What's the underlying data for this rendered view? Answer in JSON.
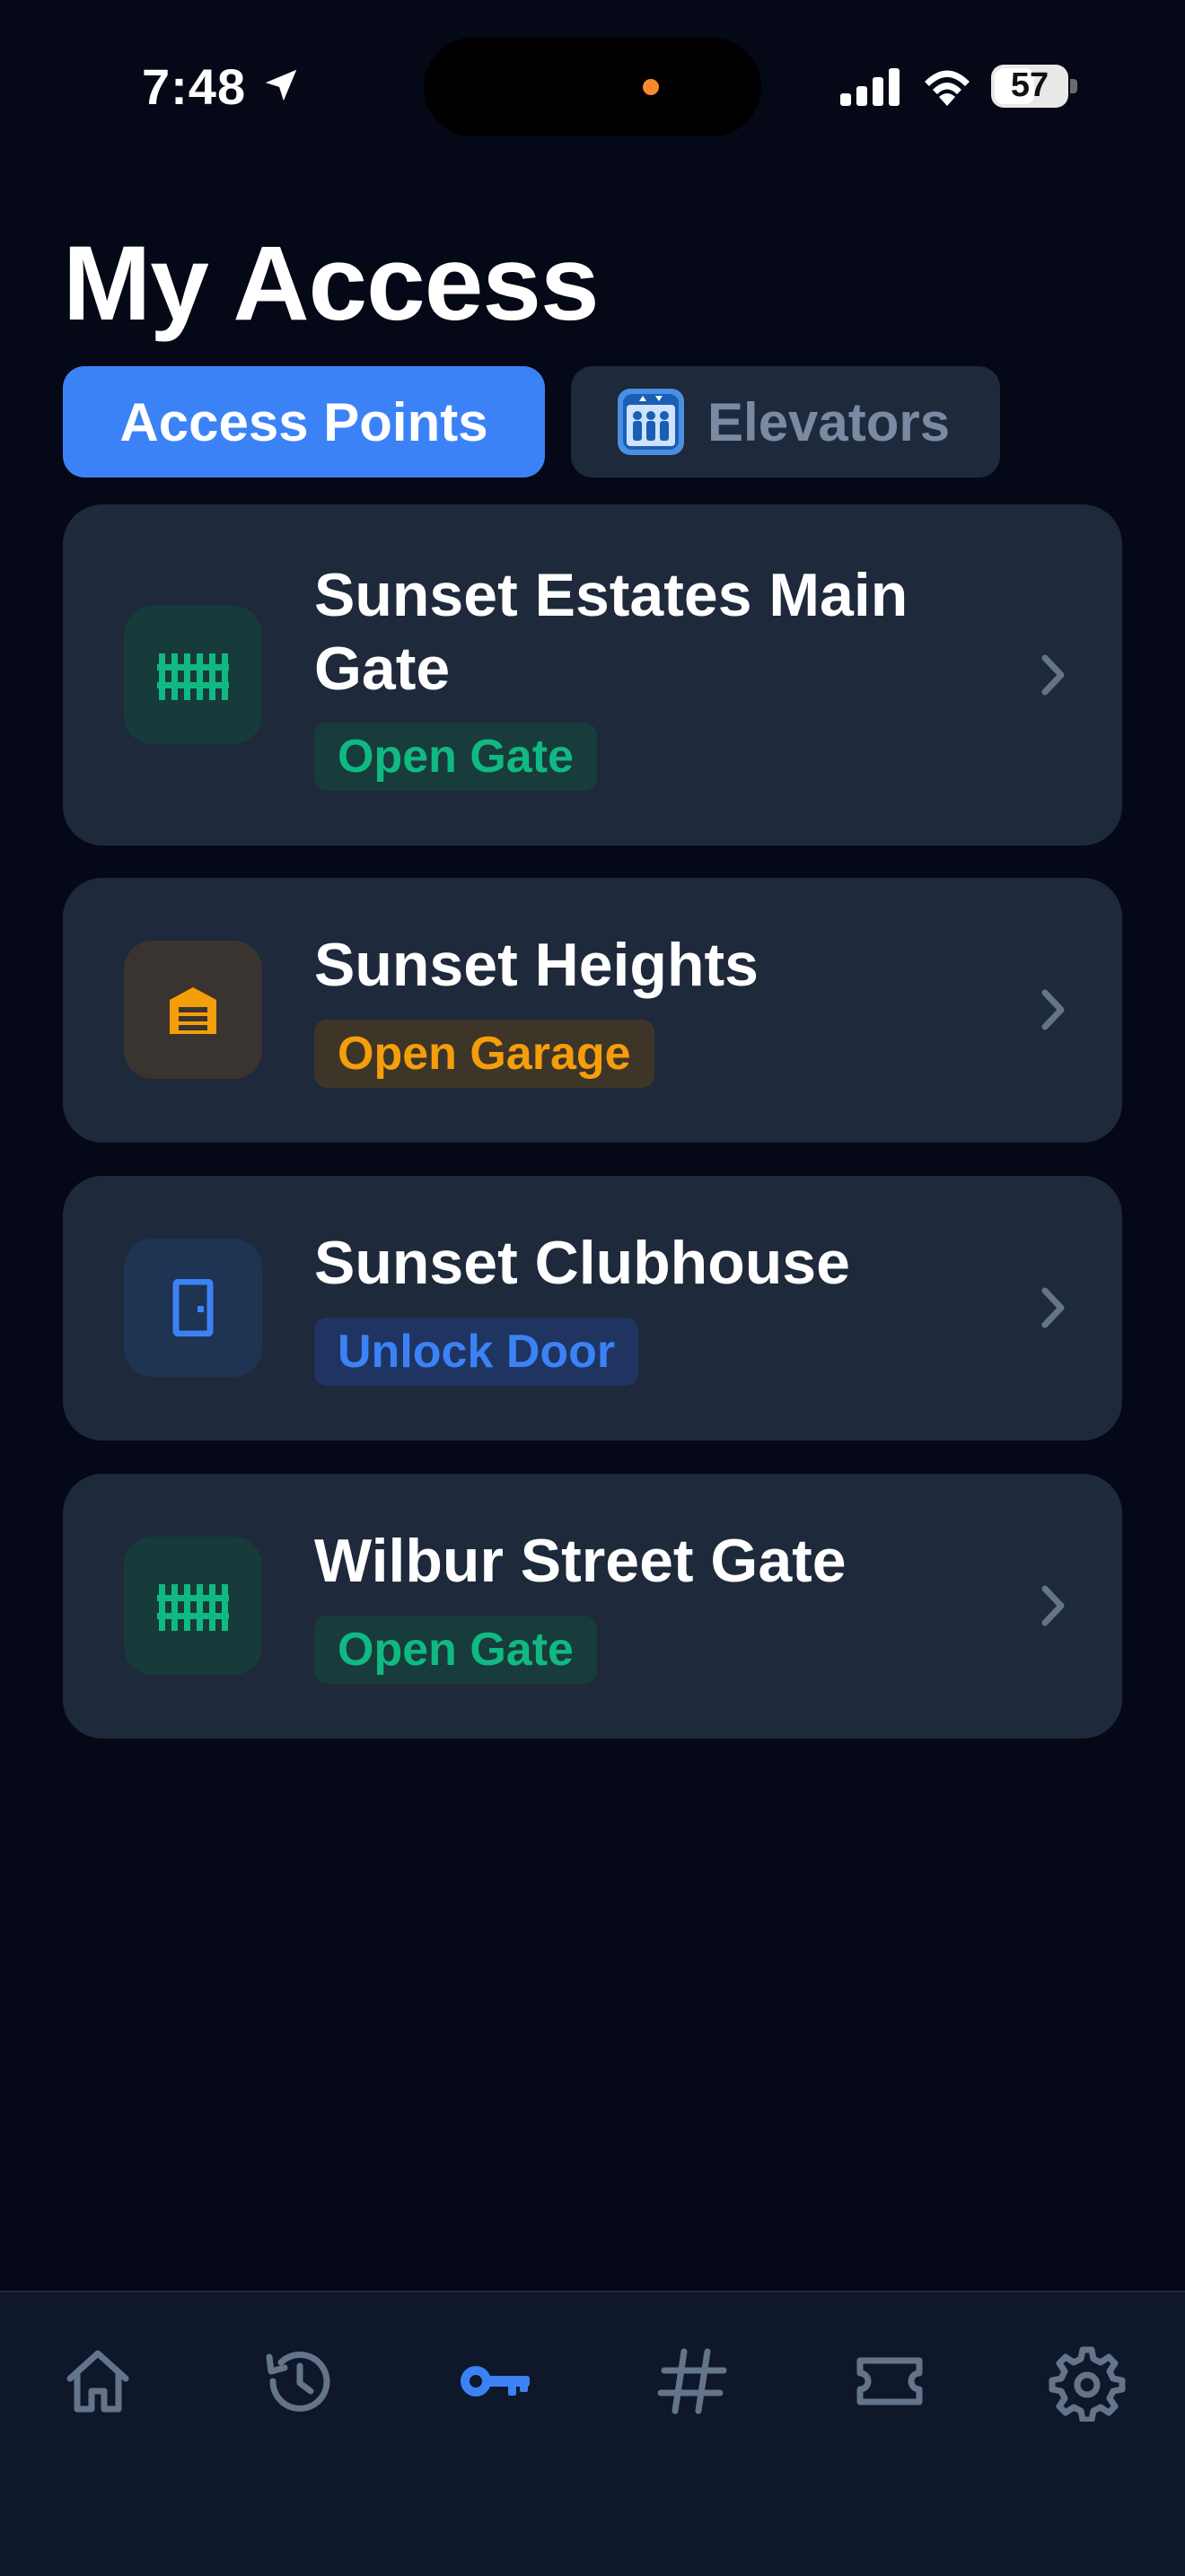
{
  "status_bar": {
    "time": "7:48",
    "battery": "57",
    "battery_level_percent": 57
  },
  "page": {
    "title": "My Access"
  },
  "tabs": [
    {
      "label": "Access Points",
      "active": true
    },
    {
      "label": "Elevators",
      "active": false,
      "icon": "elevator-icon"
    }
  ],
  "access_points": [
    {
      "name": "Sunset Estates Main Gate",
      "action": "Open Gate",
      "icon": "gate-icon",
      "color": "#10b981"
    },
    {
      "name": "Sunset Heights",
      "action": "Open Garage",
      "icon": "garage-icon",
      "color": "#f59e0b"
    },
    {
      "name": "Sunset Clubhouse",
      "action": "Unlock Door",
      "icon": "door-icon",
      "color": "#3b82f6"
    },
    {
      "name": "Wilbur Street Gate",
      "action": "Open Gate",
      "icon": "gate-icon",
      "color": "#10b981"
    }
  ],
  "bottom_nav": [
    {
      "icon": "home-icon",
      "active": false
    },
    {
      "icon": "history-icon",
      "active": false
    },
    {
      "icon": "key-icon",
      "active": true
    },
    {
      "icon": "hashtag-icon",
      "active": false
    },
    {
      "icon": "ticket-icon",
      "active": false
    },
    {
      "icon": "gear-icon",
      "active": false
    }
  ],
  "colors": {
    "background": "#050816",
    "card": "#1e293b",
    "accent": "#3b82f6",
    "inactive_icon": "#64748b"
  }
}
